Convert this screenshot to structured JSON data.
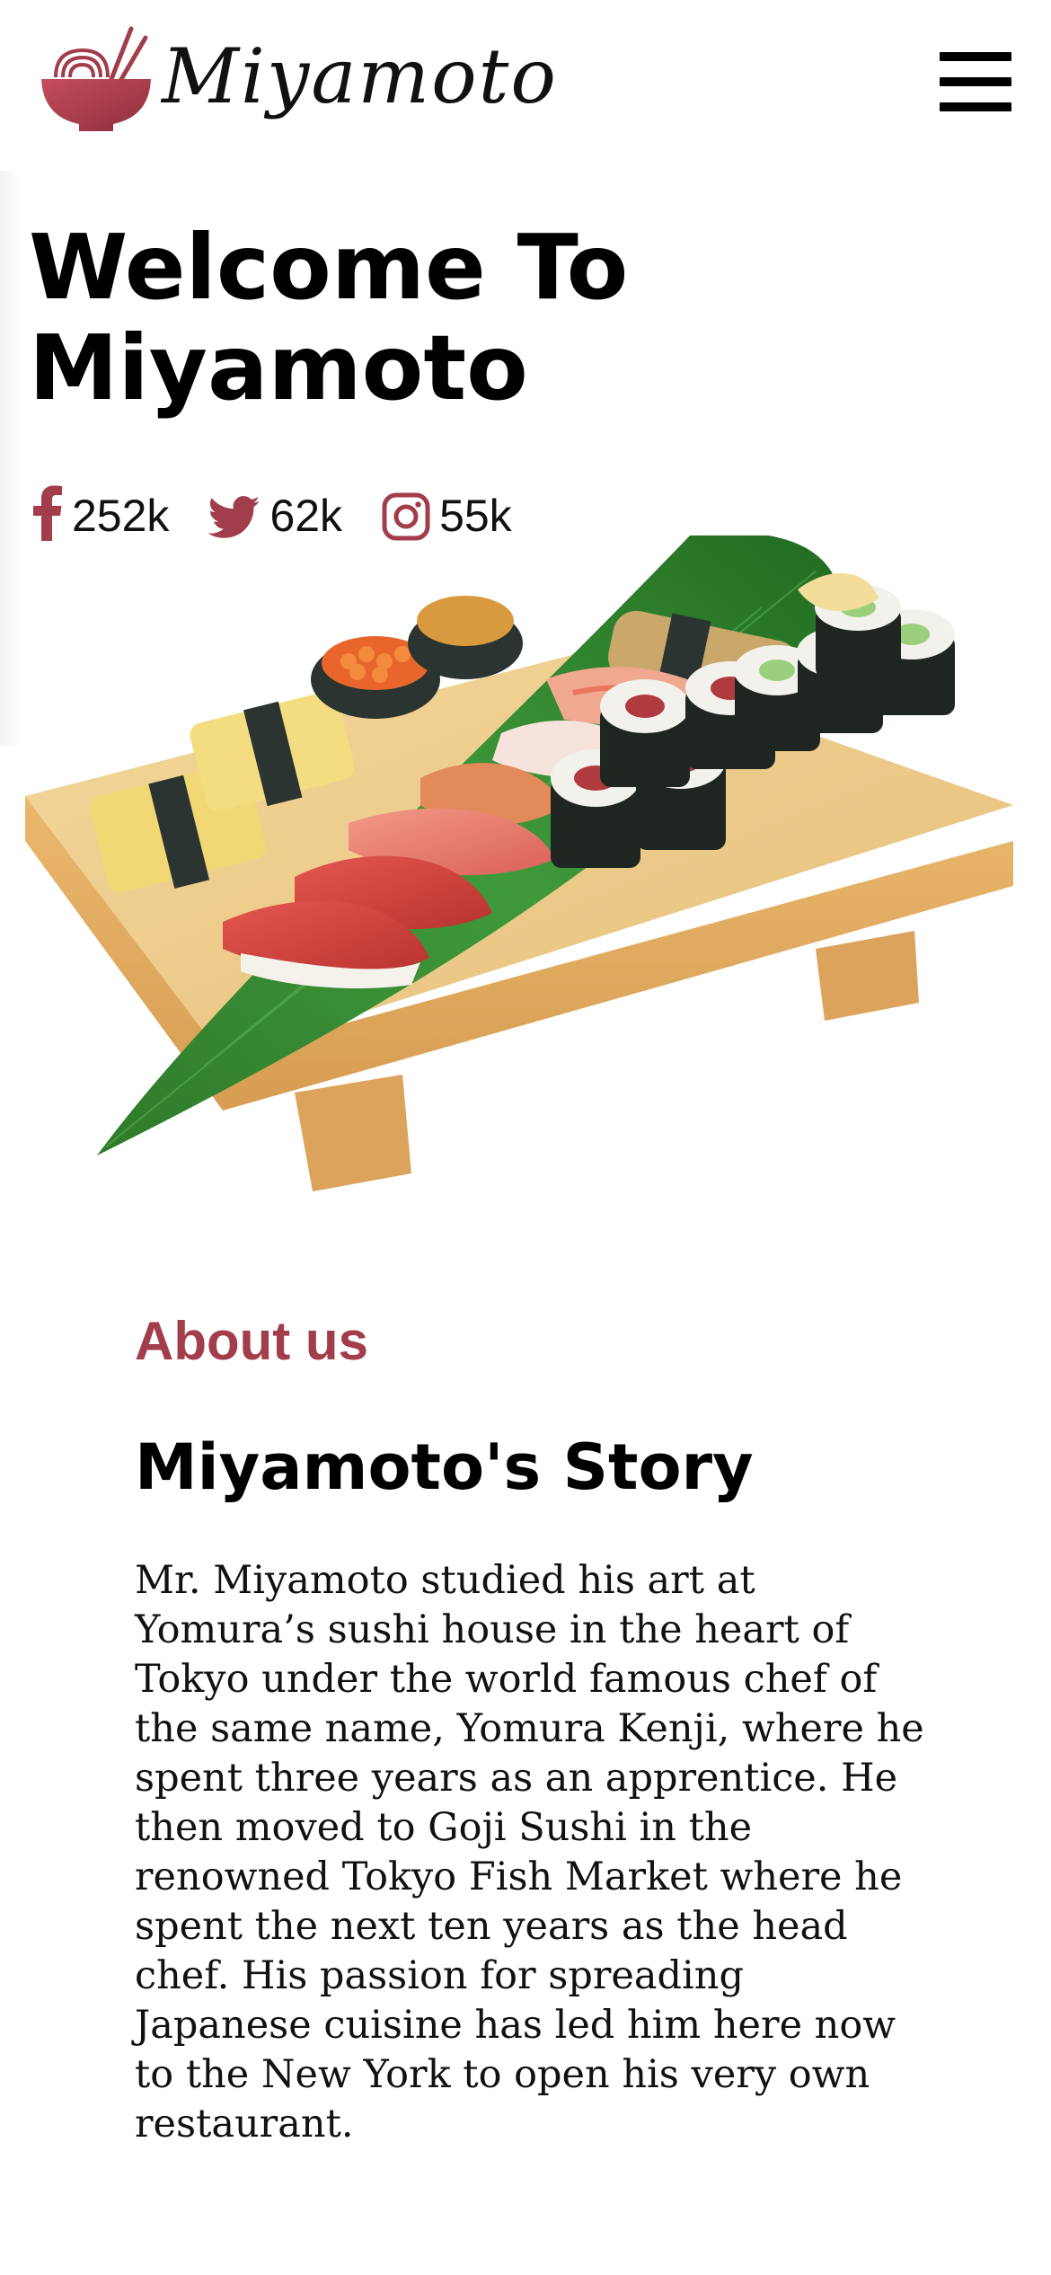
{
  "header": {
    "brand_name": "Miyamoto",
    "logo_icon": "ramen-bowl-icon",
    "menu_icon": "hamburger-menu-icon"
  },
  "hero": {
    "title_line_1": "Welcome To",
    "title_line_2": "Miyamoto",
    "image": "sushi-platter-image"
  },
  "social": [
    {
      "icon": "facebook-icon",
      "count": "252k"
    },
    {
      "icon": "twitter-icon",
      "count": "62k"
    },
    {
      "icon": "instagram-icon",
      "count": "55k"
    }
  ],
  "about": {
    "eyebrow": "About us",
    "title": "Miyamoto's Story",
    "body": "Mr. Miyamoto studied his art at Yomura’s sushi house in the heart of Tokyo under the world famous chef of the same name, Yomura Kenji, where he spent three years as an apprentice. He then moved to Goji Sushi in the renowned Tokyo Fish Market where he spent the next ten years as the head chef. His passion for spreading Japanese cuisine has led him here now to the New York to open his very own restaurant."
  },
  "colors": {
    "accent": "#a23d4b",
    "text": "#000000",
    "background": "#ffffff"
  }
}
